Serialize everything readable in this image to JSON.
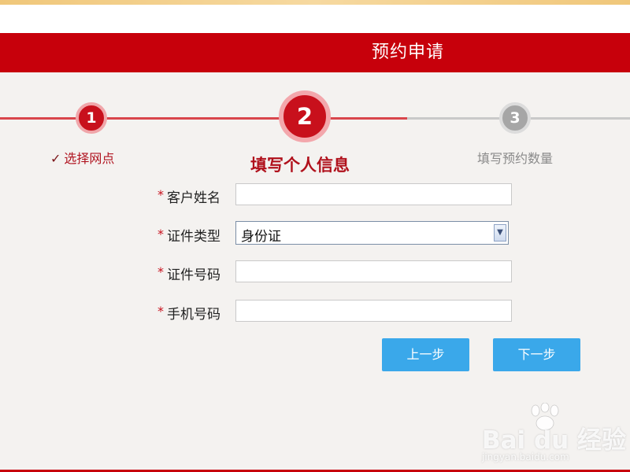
{
  "header": {
    "title": "预约申请"
  },
  "steps": [
    {
      "number": "1",
      "label": "选择网点",
      "check": "✓",
      "state": "done"
    },
    {
      "number": "2",
      "label": "填写个人信息",
      "state": "current"
    },
    {
      "number": "3",
      "label": "填写预约数量",
      "state": "todo"
    }
  ],
  "form": {
    "required_mark": "*",
    "fields": [
      {
        "label": "客户姓名",
        "value": ""
      },
      {
        "label": "证件类型",
        "value": "身份证"
      },
      {
        "label": "证件号码",
        "value": ""
      },
      {
        "label": "手机号码",
        "value": ""
      }
    ]
  },
  "buttons": {
    "prev": "上一步",
    "next": "下一步"
  },
  "watermark": {
    "brand": "Bai du 经验",
    "url": "jingyan.baidu.com"
  },
  "colors": {
    "primary_red": "#c7000b",
    "button_blue": "#3aa8ea",
    "inactive_gray": "#a6a6a6"
  }
}
